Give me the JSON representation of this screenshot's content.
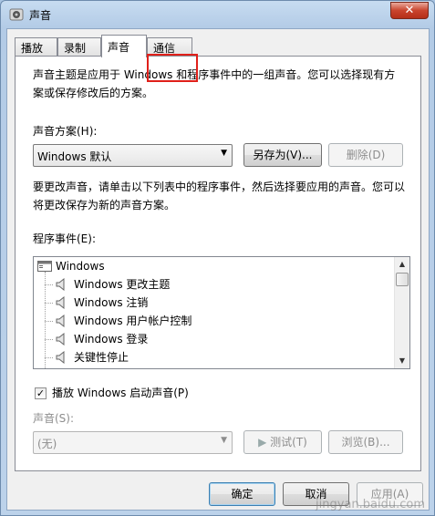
{
  "window": {
    "title": "声音",
    "close_glyph": "✕"
  },
  "tabs": [
    {
      "label": "播放"
    },
    {
      "label": "录制"
    },
    {
      "label": "声音"
    },
    {
      "label": "通信"
    }
  ],
  "panel": {
    "description": "声音主题是应用于 Windows 和程序事件中的一组声音。您可以选择现有方案或保存修改后的方案。",
    "scheme_label": "声音方案(H):",
    "scheme_value": "Windows 默认",
    "save_as_label": "另存为(V)...",
    "delete_label": "删除(D)",
    "instruction": "要更改声音，请单击以下列表中的程序事件，然后选择要应用的声音。您可以将更改保存为新的声音方案。",
    "events_label": "程序事件(E):",
    "events": [
      {
        "label": "Windows"
      },
      {
        "label": "Windows 更改主题"
      },
      {
        "label": "Windows 注销"
      },
      {
        "label": "Windows 用户帐户控制"
      },
      {
        "label": "Windows 登录"
      },
      {
        "label": "关键性停止"
      }
    ],
    "startup_sound_label": "播放 Windows 启动声音(P)",
    "startup_sound_checked": true,
    "sound_label": "声音(S):",
    "sound_value": "(无)",
    "test_label": "测试(T)",
    "browse_label": "浏览(B)..."
  },
  "buttons": {
    "ok": "确定",
    "cancel": "取消",
    "apply": "应用(A)"
  },
  "watermark": "jingyan.baidu.com"
}
